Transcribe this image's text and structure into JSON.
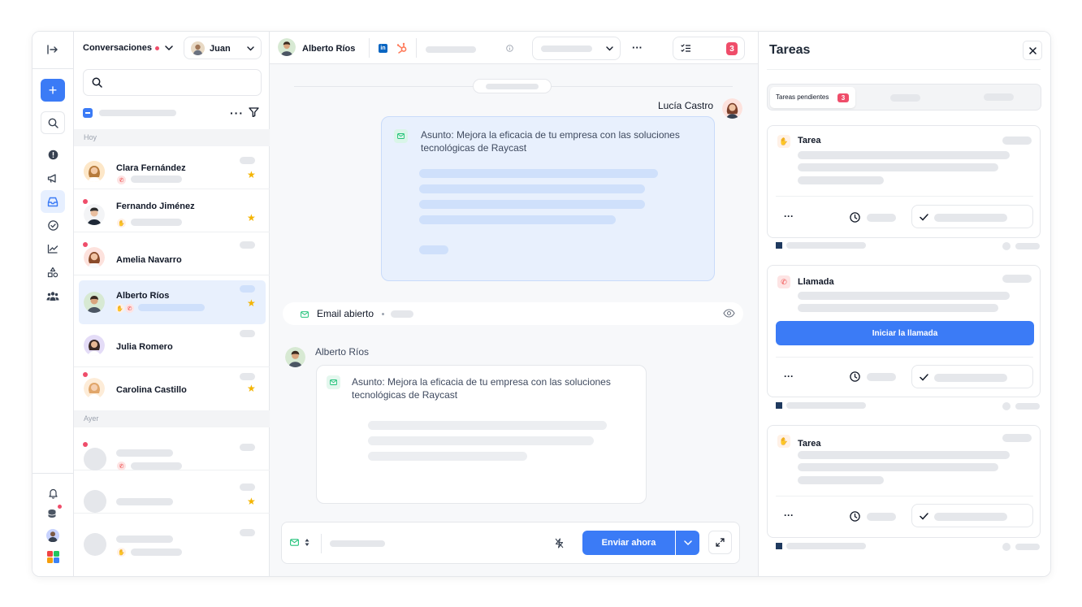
{
  "colors": {
    "accent": "#3b7bf6",
    "badge": "#ef4d6a",
    "star": "#f4b400",
    "email_green": "#22c27a",
    "message_blue_bg": "#e8f0fd"
  },
  "nav_rail": {
    "icons": [
      "sidebar-toggle-icon",
      "plus-icon",
      "search-icon",
      "alert-circle-icon",
      "megaphone-icon",
      "inbox-icon",
      "check-circle-icon",
      "chart-icon",
      "shapes-icon",
      "team-icon",
      "bell-icon",
      "database-icon",
      "user-avatar",
      "apps-grid-icon"
    ]
  },
  "conversations": {
    "title": "Conversaciones",
    "agent_name": "Juan",
    "group_today": "Hoy",
    "group_yesterday": "Ayer",
    "items": [
      {
        "name": "Clara Fernández"
      },
      {
        "name": "Fernando Jiménez"
      },
      {
        "name": "Amelia Navarro"
      },
      {
        "name": "Alberto Ríos"
      },
      {
        "name": "Julia Romero"
      },
      {
        "name": "Carolina Castillo"
      }
    ]
  },
  "chat": {
    "contact_name": "Alberto Ríos",
    "sender_top": "Lucía Castro",
    "subject_top": "Asunto: Mejora la eficacia de tu empresa con las soluciones tecnológicas de Raycast",
    "email_event": "Email abierto",
    "sender_bottom": "Alberto Ríos",
    "subject_bottom": "Asunto: Mejora la eficacia de tu empresa con las soluciones tecnológicas de Raycast",
    "tasks_count": "3",
    "send_label": "Enviar ahora"
  },
  "tasks_panel": {
    "title": "Tareas",
    "tab_pending": "Tareas pendientes",
    "tab_pending_count": "3",
    "cards": [
      {
        "title": "Tarea"
      },
      {
        "title": "Llamada",
        "action": "Iniciar la llamada"
      },
      {
        "title": "Tarea"
      }
    ]
  }
}
